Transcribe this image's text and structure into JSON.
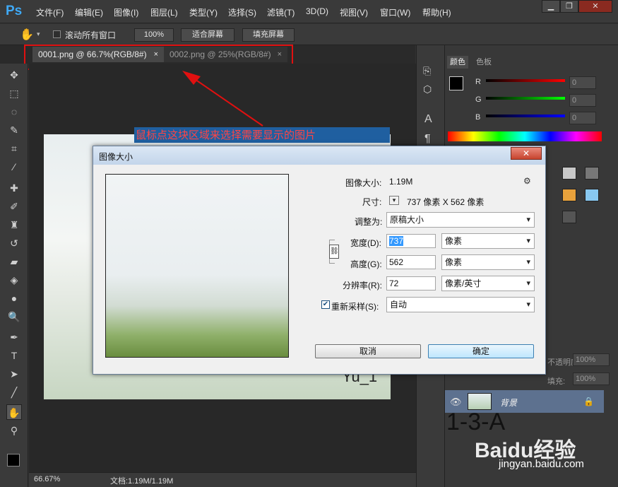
{
  "app": {
    "logo": "Ps"
  },
  "menu": [
    "文件(F)",
    "编辑(E)",
    "图像(I)",
    "图层(L)",
    "类型(Y)",
    "选择(S)",
    "滤镜(T)",
    "3D(D)",
    "视图(V)",
    "窗口(W)",
    "帮助(H)"
  ],
  "window_controls": {
    "minimize": "▁",
    "restore": "❐",
    "close": "✕"
  },
  "options": {
    "scroll_all": "滚动所有窗口",
    "zoom100": "100%",
    "fit_screen": "适合屏幕",
    "fill_screen": "填充屏幕"
  },
  "tabs": [
    {
      "label": "0001.png @ 66.7%(RGB/8#)",
      "close": "×"
    },
    {
      "label": "0002.png @ 25%(RGB/8#)",
      "close": "×"
    }
  ],
  "annotation": "鼠标点这块区域来选择需要显示的图片",
  "canvas": {
    "watermark": "Yu_1"
  },
  "status": {
    "zoom": "66.67%",
    "doc": "文档:1.19M/1.19M"
  },
  "panel": {
    "tab_color": "颜色",
    "tab_swatches": "色板",
    "r": "R",
    "g": "G",
    "b": "B",
    "rv": "0",
    "gv": "0",
    "bv": "0",
    "opacity_label": "不透明度:",
    "opacity": "100%",
    "fill_label": "填充:",
    "fill": "100%",
    "layer_name": "背景",
    "wm_big": "1-3-A",
    "baidu": "Baidu经验",
    "baidu_url": "jingyan.baidu.com"
  },
  "colors": {
    "accent_red": "#e01010",
    "ps_blue": "#3fa9f5",
    "layer_sel": "#5d718f"
  },
  "dialog": {
    "title": "图像大小",
    "size_label": "图像大小:",
    "size_value": "1.19M",
    "dim_label": "尺寸:",
    "dim_value": "737 像素  X  562 像素",
    "fit_label": "调整为:",
    "fit_value": "原稿大小",
    "width_label": "宽度(D):",
    "width_value": "737",
    "width_unit": "像素",
    "height_label": "高度(G):",
    "height_value": "562",
    "height_unit": "像素",
    "res_label": "分辨率(R):",
    "res_value": "72",
    "res_unit": "像素/英寸",
    "resample_label": "重新采样(S):",
    "resample_value": "自动",
    "cancel": "取消",
    "ok": "确定",
    "close": "✕"
  }
}
